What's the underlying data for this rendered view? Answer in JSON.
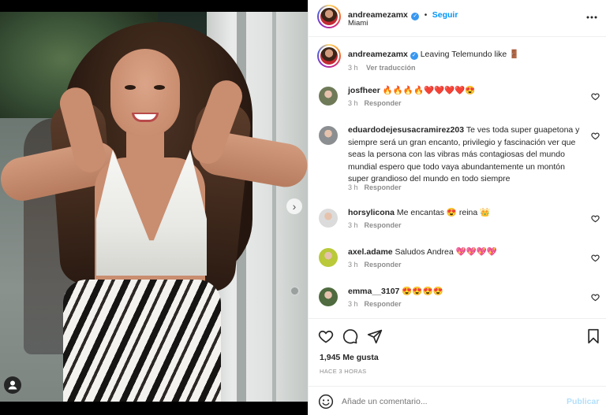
{
  "post": {
    "username": "andreamezamx",
    "follow_label": "Seguir",
    "location": "Miami",
    "separator": "•",
    "caption_text": "Leaving Telemundo like",
    "caption_emoji": "🚪",
    "caption_time": "3 h",
    "translate_label": "Ver traducción",
    "likes": "1,945 Me gusta",
    "posted_ago": "HACE 3 HORAS"
  },
  "comments": [
    {
      "user": "josfheer",
      "text": "🔥🔥🔥🔥❤️❤️❤️❤️😍",
      "time": "3 h",
      "reply": "Responder",
      "avatar_color": "#6f7a58"
    },
    {
      "user": "eduardodejesusacramirez203",
      "text": "Te ves toda super guapetona y siempre será un gran encanto, privilegio y fascinación ver que seas la persona con las vibras más contagiosas del mundo mundial espero que todo vaya abundantemente un montón super grandioso del mundo en todo siempre",
      "time": "3 h",
      "reply": "Responder",
      "avatar_color": "#8c8f91"
    },
    {
      "user": "horsylicona",
      "text": "Me encantas 😍 reina 👑",
      "time": "3 h",
      "reply": "Responder",
      "avatar_color": "#dbdbdb"
    },
    {
      "user": "axel.adame",
      "text": "Saludos Andrea 💖💖💖💖",
      "time": "3 h",
      "reply": "Responder",
      "avatar_color": "#b9c93a"
    },
    {
      "user": "emma__3107",
      "text": "😍😍😍😍",
      "time": "3 h",
      "reply": "Responder",
      "avatar_color": "#4f6b3f"
    }
  ],
  "add_comment": {
    "placeholder": "Añade un comentario...",
    "publish_label": "Publicar"
  },
  "icons": {
    "more": "more-options-icon",
    "like": "heart-icon",
    "comment": "comment-icon",
    "share": "send-icon",
    "save": "bookmark-icon",
    "emoji": "emoji-icon",
    "next": "chevron-right-icon",
    "tag": "user-tag-icon"
  },
  "colors": {
    "accent": "#0095f6",
    "verified": "#3897f0",
    "muted": "#8e8e8e",
    "publish_disabled": "#b2dffc"
  }
}
